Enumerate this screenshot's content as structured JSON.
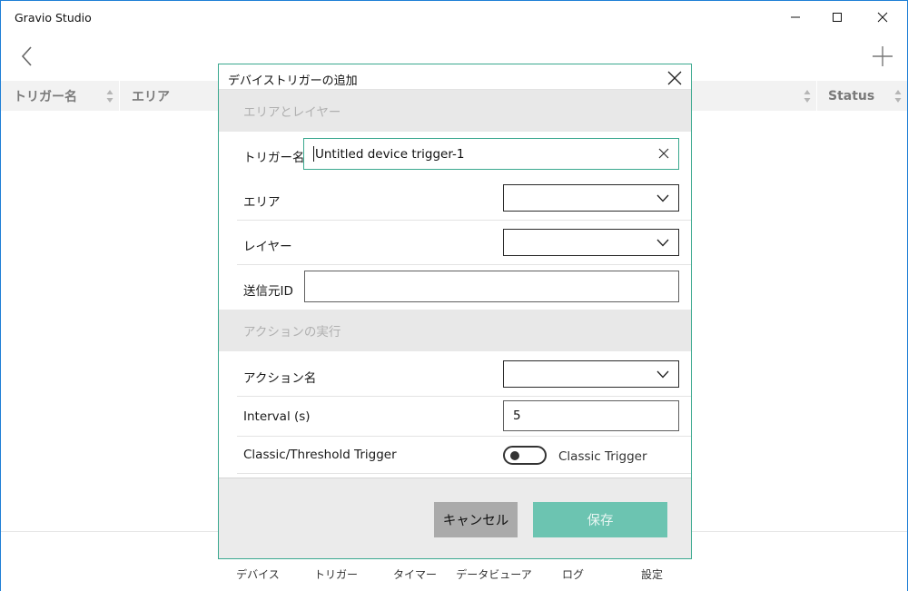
{
  "window": {
    "title": "Gravio Studio",
    "controls": [
      "minimize-icon",
      "maximize-icon",
      "close-icon"
    ]
  },
  "toolbar": {
    "back_icon": "chevron-left-icon",
    "add_icon": "plus-icon"
  },
  "table": {
    "columns": [
      "トリガー名",
      "エリア",
      "",
      "Status"
    ]
  },
  "bottom_nav": {
    "items": [
      "デバイス",
      "トリガー",
      "タイマー",
      "データビューア",
      "ログ",
      "設定"
    ]
  },
  "dialog": {
    "title": "デバイストリガーの追加",
    "section_area_layer": "エリアとレイヤー",
    "trigger_name_label": "トリガー名",
    "trigger_name_value": "Untitled device trigger-1",
    "area_label": "エリア",
    "area_value": "",
    "layer_label": "レイヤー",
    "layer_value": "",
    "sender_id_label": "送信元ID",
    "sender_id_value": "",
    "section_action": "アクションの実行",
    "action_name_label": "アクション名",
    "action_name_value": "",
    "interval_label": "Interval (s)",
    "interval_value": "5",
    "trigger_mode_label": "Classic/Threshold Trigger",
    "trigger_mode_toggle_on": false,
    "trigger_mode_value": "Classic Trigger",
    "cancel_label": "キャンセル",
    "save_label": "保存"
  },
  "colors": {
    "accent": "#3aa88f",
    "save_button": "#6cc4b1",
    "cancel_button": "#aaaaaa",
    "window_border": "#1f7fd6"
  }
}
